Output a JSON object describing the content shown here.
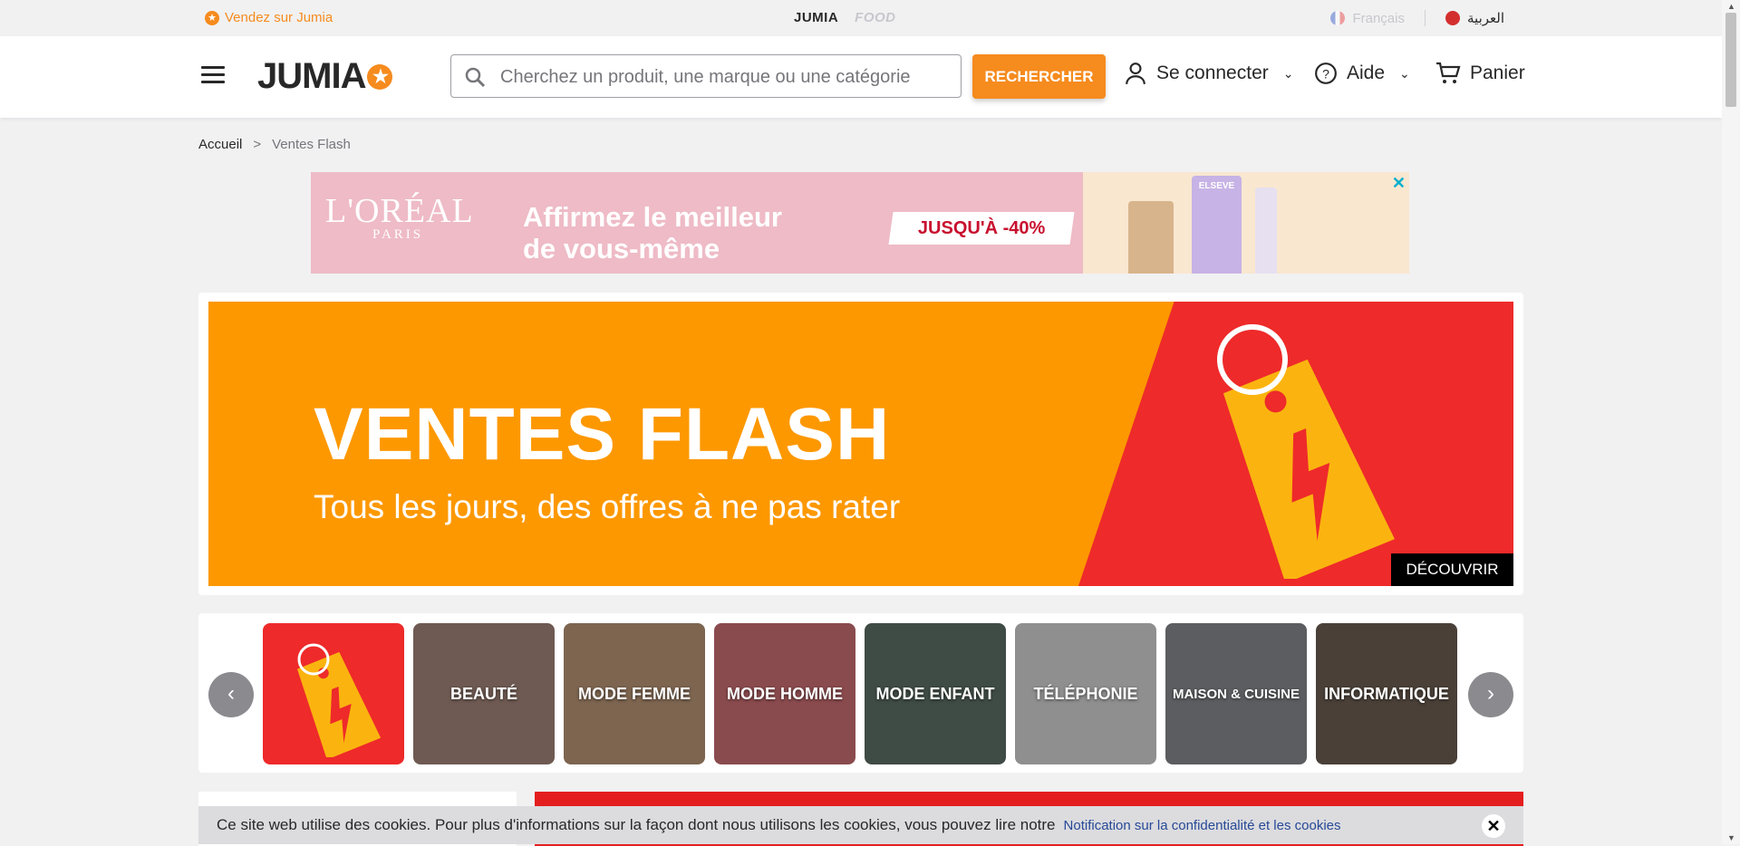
{
  "topbar": {
    "sell_label": "Vendez sur Jumia",
    "brand_main": "JUMIA",
    "brand_food": "FOOD",
    "lang_fr": "Français",
    "lang_ar": "العربية"
  },
  "header": {
    "logo_text": "JUMIA",
    "search_placeholder": "Cherchez un produit, une marque ou une catégorie",
    "search_button": "RECHERCHER",
    "signin": "Se connecter",
    "help": "Aide",
    "cart": "Panier"
  },
  "breadcrumb": {
    "home": "Accueil",
    "separator": ">",
    "current": "Ventes Flash"
  },
  "ad": {
    "brand": "L'ORÉAL",
    "brand_sub": "PARIS",
    "tagline_1": "Affirmez le meilleur",
    "tagline_2": "de vous-même",
    "promo": "JUSQU'À -40%",
    "product_label": "ELSEVE"
  },
  "hero": {
    "title": "VENTES FLASH",
    "subtitle": "Tous les jours, des offres à ne pas rater",
    "cta": "DÉCOUVRIR"
  },
  "categories": [
    {
      "label": "",
      "bg": "#ee2a2a"
    },
    {
      "label": "BEAUTÉ",
      "bg": "#6e5a52"
    },
    {
      "label": "MODE FEMME",
      "bg": "#7d6550"
    },
    {
      "label": "MODE HOMME",
      "bg": "#8a4b4e"
    },
    {
      "label": "MODE ENFANT",
      "bg": "#3f4b45"
    },
    {
      "label": "TÉLÉPHONIE",
      "bg": "#8f8f8f"
    },
    {
      "label": "MAISON & CUISINE",
      "bg": "#5b5d60"
    },
    {
      "label": "INFORMATIQUE",
      "bg": "#4a4038"
    }
  ],
  "cookie": {
    "message": "Ce site web utilise des cookies. Pour plus d'informations sur la façon dont nous utilisons les cookies, vous pouvez lire notre",
    "link": "Notification sur la confidentialité et les cookies"
  },
  "colors": {
    "accent": "#f68b1e",
    "flash_orange": "#fd9800",
    "flash_red": "#ee2a2a"
  }
}
